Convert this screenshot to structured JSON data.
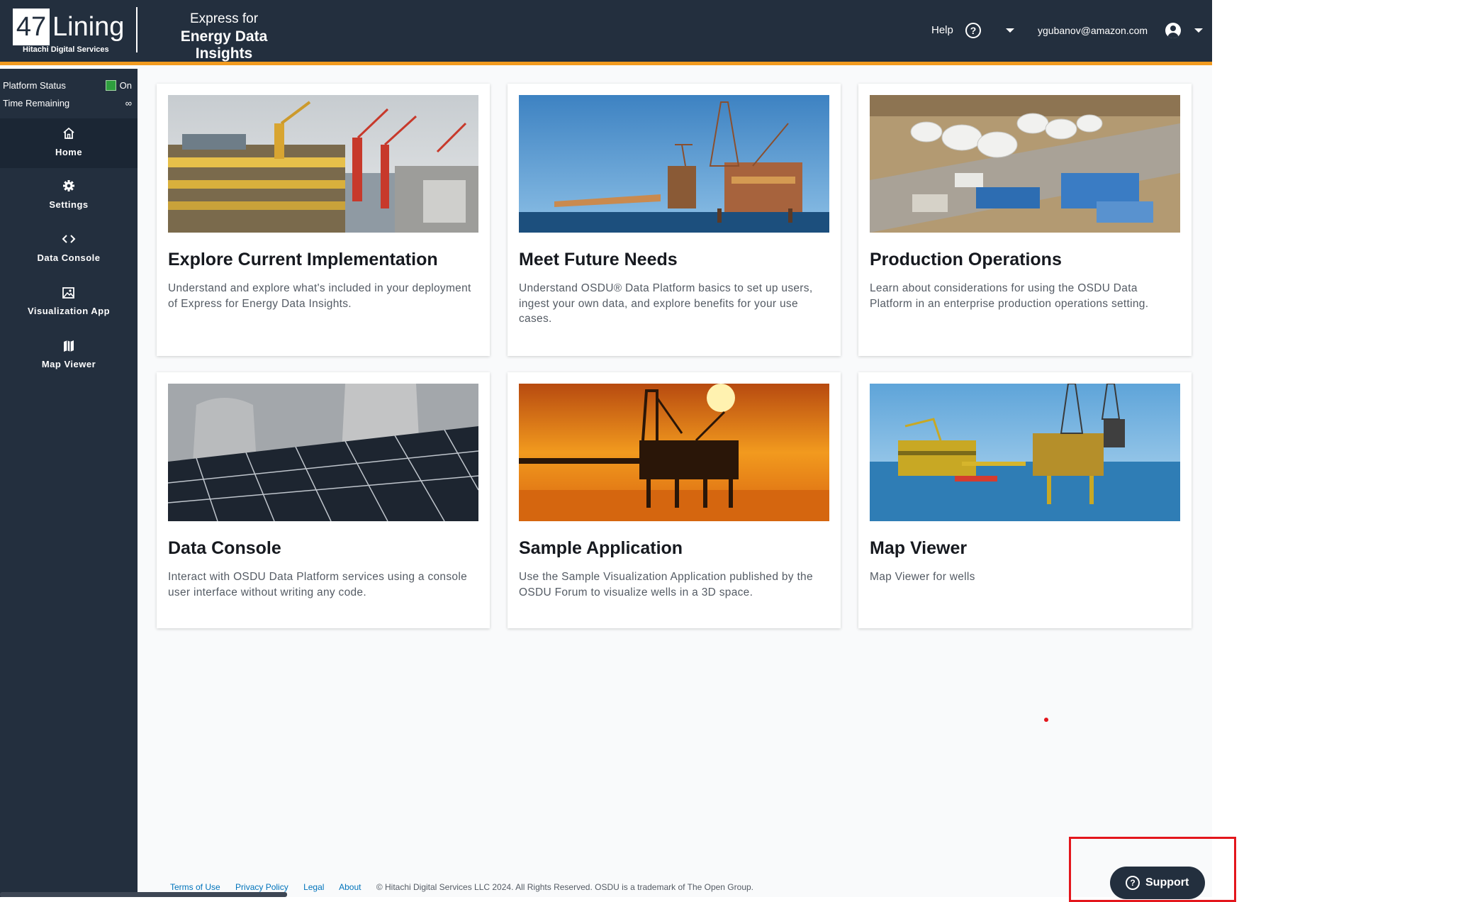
{
  "header": {
    "logo_number": "47",
    "logo_name": "Lining",
    "logo_subtitle": "Hitachi Digital Services",
    "product_line1": "Express for",
    "product_line2": "Energy Data Insights",
    "help_label": "Help",
    "help_icon": "?",
    "user_email": "ygubanov@amazon.com",
    "accent_color": "#f29b1f",
    "background_color": "#232f3e"
  },
  "sidebar": {
    "platform_status_label": "Platform Status",
    "platform_status_value": "On",
    "time_remaining_label": "Time Remaining",
    "time_remaining_value": "∞",
    "status_color": "#2e9e3e",
    "nav": [
      {
        "label": "Home",
        "icon": "home-icon",
        "active": true
      },
      {
        "label": "Settings",
        "icon": "gear-icon",
        "active": false
      },
      {
        "label": "Data Console",
        "icon": "code-icon",
        "active": false
      },
      {
        "label": "Visualization App",
        "icon": "image-icon",
        "active": false
      },
      {
        "label": "Map Viewer",
        "icon": "map-icon",
        "active": false
      }
    ]
  },
  "cards": [
    {
      "title": "Explore Current Implementation",
      "description": "Understand and explore what's included in your deployment of Express for Energy Data Insights.",
      "image": "offshore-platform-cranes"
    },
    {
      "title": "Meet Future Needs",
      "description": "Understand OSDU® Data Platform basics to set up users, ingest your own data, and explore benefits for your use cases.",
      "image": "offshore-rig-blue-sky"
    },
    {
      "title": "Production Operations",
      "description": "Learn about considerations for using the OSDU Data Platform in an enterprise production operations setting.",
      "image": "storage-tank-facility"
    },
    {
      "title": "Data Console",
      "description": "Interact with OSDU Data Platform services using a console user interface without writing any code.",
      "image": "solar-panels-cooling-towers"
    },
    {
      "title": "Sample Application",
      "description": "Use the Sample Visualization Application published by the OSDU Forum to visualize wells in a 3D space.",
      "image": "rig-sunset"
    },
    {
      "title": "Map Viewer",
      "description": "Map Viewer for wells",
      "image": "offshore-platform-yellow"
    }
  ],
  "footer": {
    "links": [
      "Terms of Use",
      "Privacy Policy",
      "Legal",
      "About"
    ],
    "copyright": "© Hitachi Digital Services LLC 2024. All Rights Reserved. OSDU is a trademark of The Open Group."
  },
  "support": {
    "label": "Support",
    "icon": "?"
  }
}
